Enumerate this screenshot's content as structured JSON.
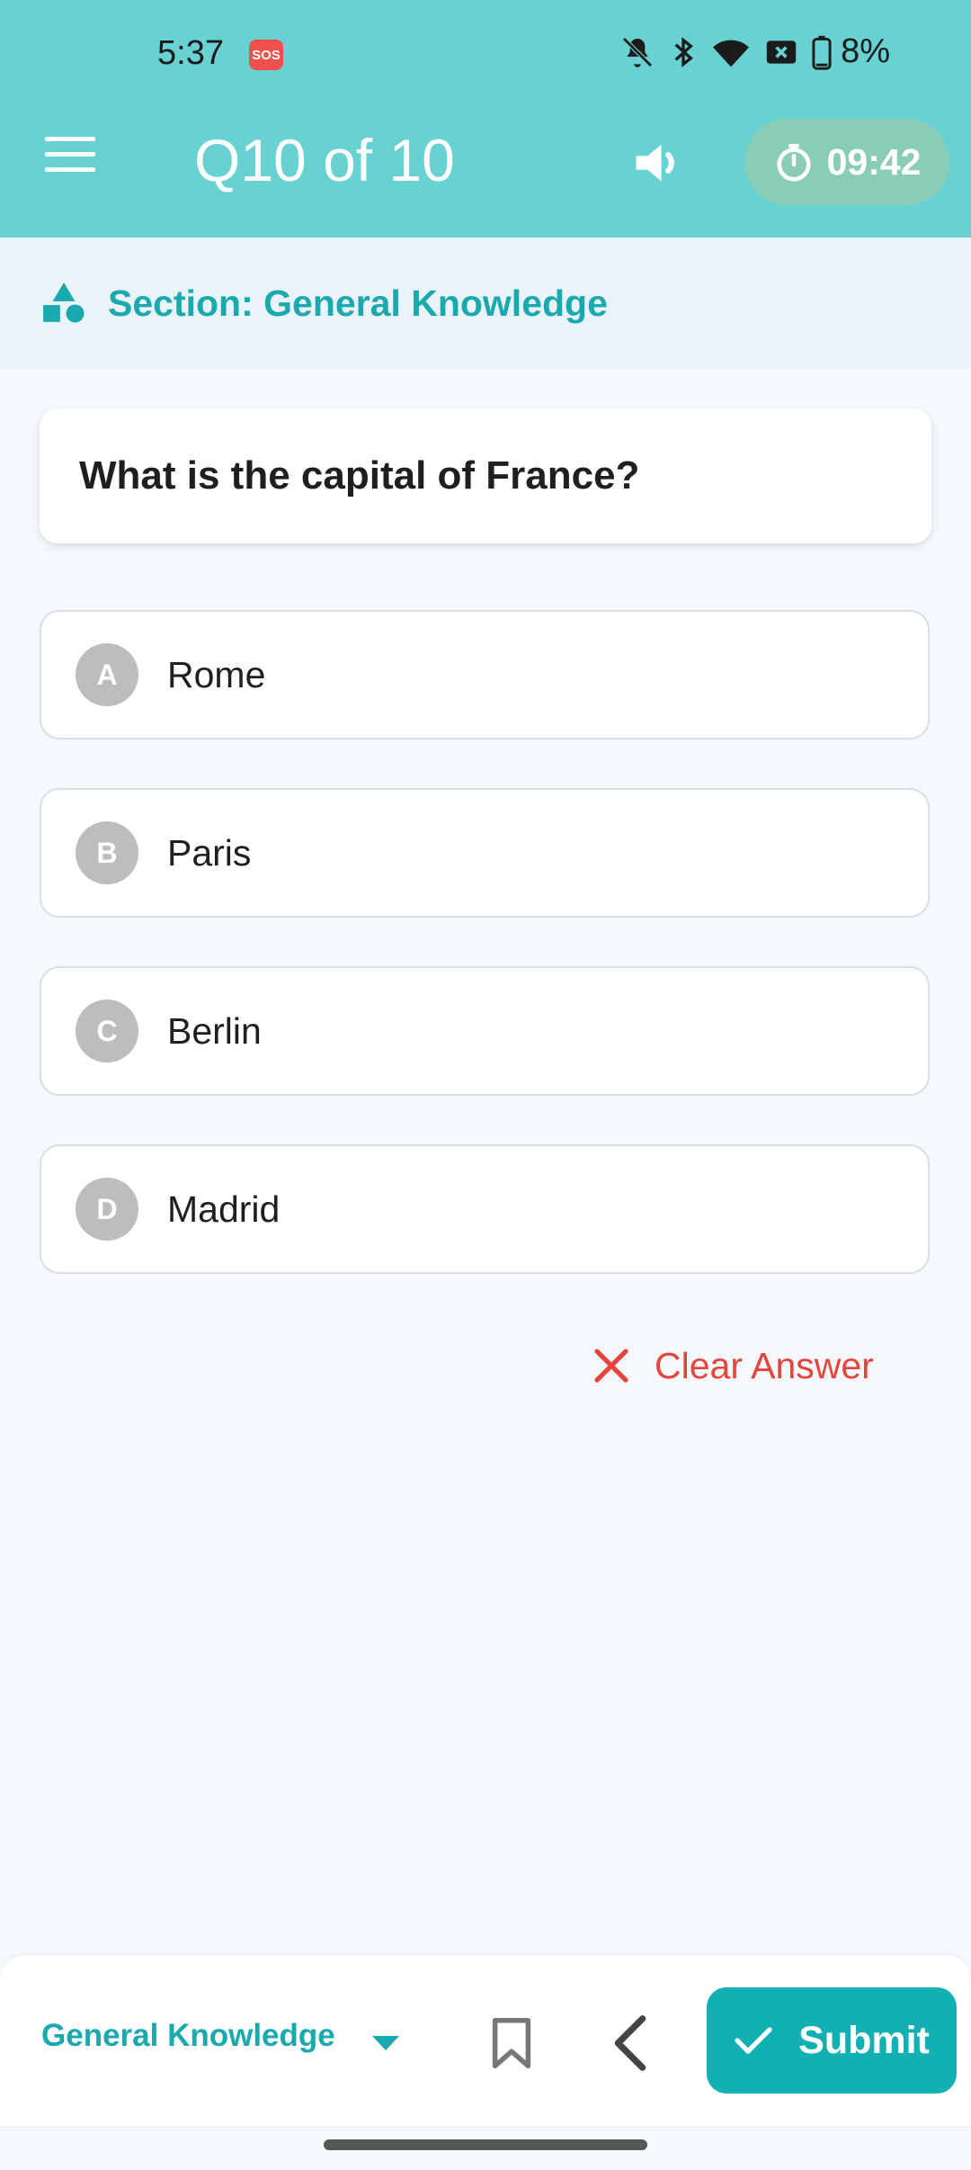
{
  "status_bar": {
    "time": "5:37",
    "sos_label": "SOS",
    "battery": "8%",
    "icons": [
      "mute-bell-icon",
      "bluetooth-icon",
      "wifi-icon",
      "sim-blocked-icon",
      "battery-icon"
    ]
  },
  "app_bar": {
    "title": "Q10 of 10",
    "timer": "09:42",
    "icons": {
      "menu": "hamburger-menu-icon",
      "volume": "volume-icon",
      "timer": "stopwatch-icon"
    }
  },
  "section": {
    "label": "Section: General Knowledge",
    "icon": "shapes-icon"
  },
  "question": {
    "text": "What is the capital of France?"
  },
  "options": [
    {
      "letter": "A",
      "text": "Rome"
    },
    {
      "letter": "B",
      "text": "Paris"
    },
    {
      "letter": "C",
      "text": "Berlin"
    },
    {
      "letter": "D",
      "text": "Madrid"
    }
  ],
  "clear_answer": {
    "label": "Clear Answer",
    "icon": "close-icon"
  },
  "bottom_bar": {
    "section_select": "General Knowledge",
    "submit_label": "Submit",
    "icons": [
      "chevron-down-icon",
      "bookmark-icon",
      "back-icon",
      "check-icon"
    ]
  },
  "colors": {
    "header": "#67D2D1",
    "accent": "#13B0B3",
    "section_text": "#1AA9AE",
    "danger": "#E5453C",
    "timer_chip": "#8ACDB7"
  }
}
